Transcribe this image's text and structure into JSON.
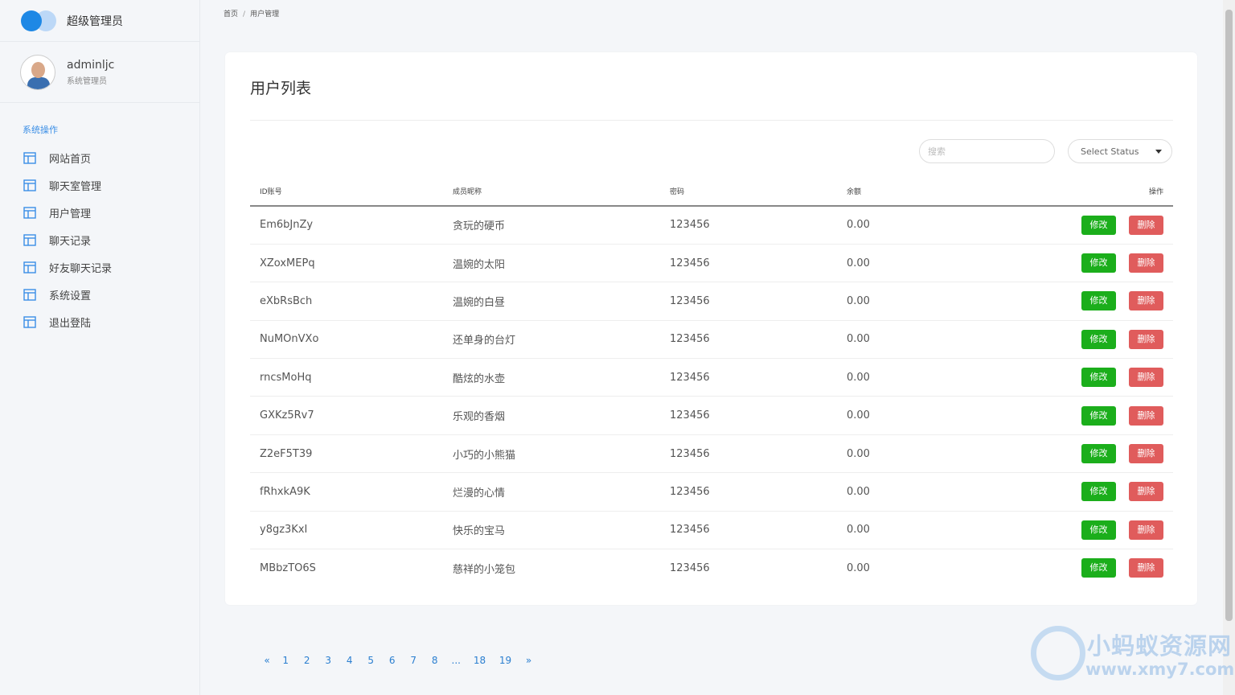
{
  "brand": {
    "title": "超级管理员",
    "logo_colors": [
      "#1e88e5",
      "#bcd8f7"
    ]
  },
  "user": {
    "name": "adminljc",
    "role": "系统管理员"
  },
  "sidebar": {
    "section_title": "系统操作",
    "items": [
      {
        "label": "网站首页",
        "icon": "layout-icon"
      },
      {
        "label": "聊天室管理",
        "icon": "layout-icon"
      },
      {
        "label": "用户管理",
        "icon": "layout-icon"
      },
      {
        "label": "聊天记录",
        "icon": "layout-icon"
      },
      {
        "label": "好友聊天记录",
        "icon": "layout-icon"
      },
      {
        "label": "系统设置",
        "icon": "layout-icon"
      },
      {
        "label": "退出登陆",
        "icon": "layout-icon"
      }
    ]
  },
  "breadcrumb": {
    "home": "首页",
    "separator": "/",
    "current": "用户管理"
  },
  "card": {
    "title": "用户列表"
  },
  "filters": {
    "search_placeholder": "搜索",
    "status_select": "Select Status"
  },
  "table": {
    "headers": [
      "ID账号",
      "成员昵称",
      "密码",
      "余额",
      "操作"
    ],
    "rows": [
      {
        "id": "Em6bJnZy",
        "nickname": "贪玩的硬币",
        "password": "123456",
        "balance": "0.00"
      },
      {
        "id": "XZoxMEPq",
        "nickname": "温婉的太阳",
        "password": "123456",
        "balance": "0.00"
      },
      {
        "id": "eXbRsBch",
        "nickname": "温婉的白昼",
        "password": "123456",
        "balance": "0.00"
      },
      {
        "id": "NuMOnVXo",
        "nickname": "还单身的台灯",
        "password": "123456",
        "balance": "0.00"
      },
      {
        "id": "rncsMoHq",
        "nickname": "酷炫的水壶",
        "password": "123456",
        "balance": "0.00"
      },
      {
        "id": "GXKz5Rv7",
        "nickname": "乐观的香烟",
        "password": "123456",
        "balance": "0.00"
      },
      {
        "id": "Z2eF5T39",
        "nickname": "小巧的小熊猫",
        "password": "123456",
        "balance": "0.00"
      },
      {
        "id": "fRhxkA9K",
        "nickname": "烂漫的心情",
        "password": "123456",
        "balance": "0.00"
      },
      {
        "id": "y8gz3KxI",
        "nickname": "快乐的宝马",
        "password": "123456",
        "balance": "0.00"
      },
      {
        "id": "MBbzTO6S",
        "nickname": "慈祥的小笼包",
        "password": "123456",
        "balance": "0.00"
      }
    ],
    "edit_label": "修改",
    "delete_label": "删除",
    "edit_color": "#1bae1b",
    "delete_color": "#e05c5c"
  },
  "pagination": {
    "prev": "«",
    "pages": [
      "1",
      "2",
      "3",
      "4",
      "5",
      "6",
      "7",
      "8",
      "...",
      "18",
      "19"
    ],
    "next": "»"
  },
  "watermark": {
    "title": "小蚂蚁资源网",
    "url": "www.xmy7.com"
  }
}
